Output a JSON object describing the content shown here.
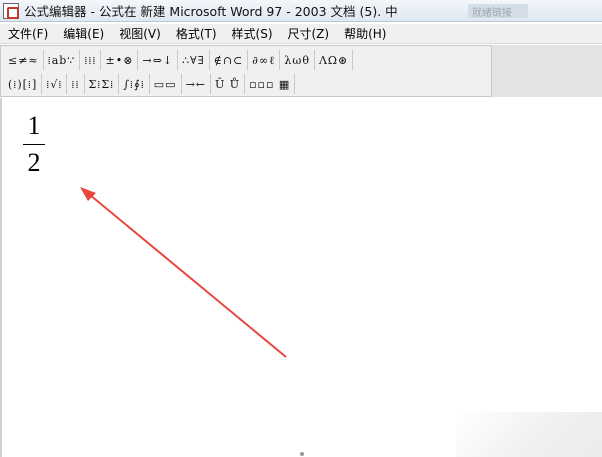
{
  "window": {
    "title": "公式编辑器 - 公式在 新建 Microsoft Word 97 - 2003 文档 (5). 中",
    "ghost_text": "就绪链接"
  },
  "menu": {
    "items": [
      {
        "label": "文件(F)"
      },
      {
        "label": "编辑(E)"
      },
      {
        "label": "视图(V)"
      },
      {
        "label": "格式(T)"
      },
      {
        "label": "样式(S)"
      },
      {
        "label": "尺寸(Z)"
      },
      {
        "label": "帮助(H)"
      }
    ]
  },
  "toolbar": {
    "row1": [
      "≤≠≈",
      "⁞ab∵",
      "⁞⁞⁞",
      "±•⊗",
      "→⇔↓",
      "∴∀∃",
      "∉∩⊂",
      "∂∞ℓ",
      "λωθ",
      "ΛΩ⊛"
    ],
    "row2": [
      "(⁞)[⁞]",
      "⁞√⁞",
      "⁞⁞",
      "Σ⁞Σ⁞",
      "∫⁞∮⁞",
      "▭▭",
      "→←",
      "Ū Ů",
      "▫▫▫ ▦"
    ]
  },
  "equation": {
    "numerator": "1",
    "denominator": "2"
  },
  "colors": {
    "arrow": "#e8463f"
  }
}
